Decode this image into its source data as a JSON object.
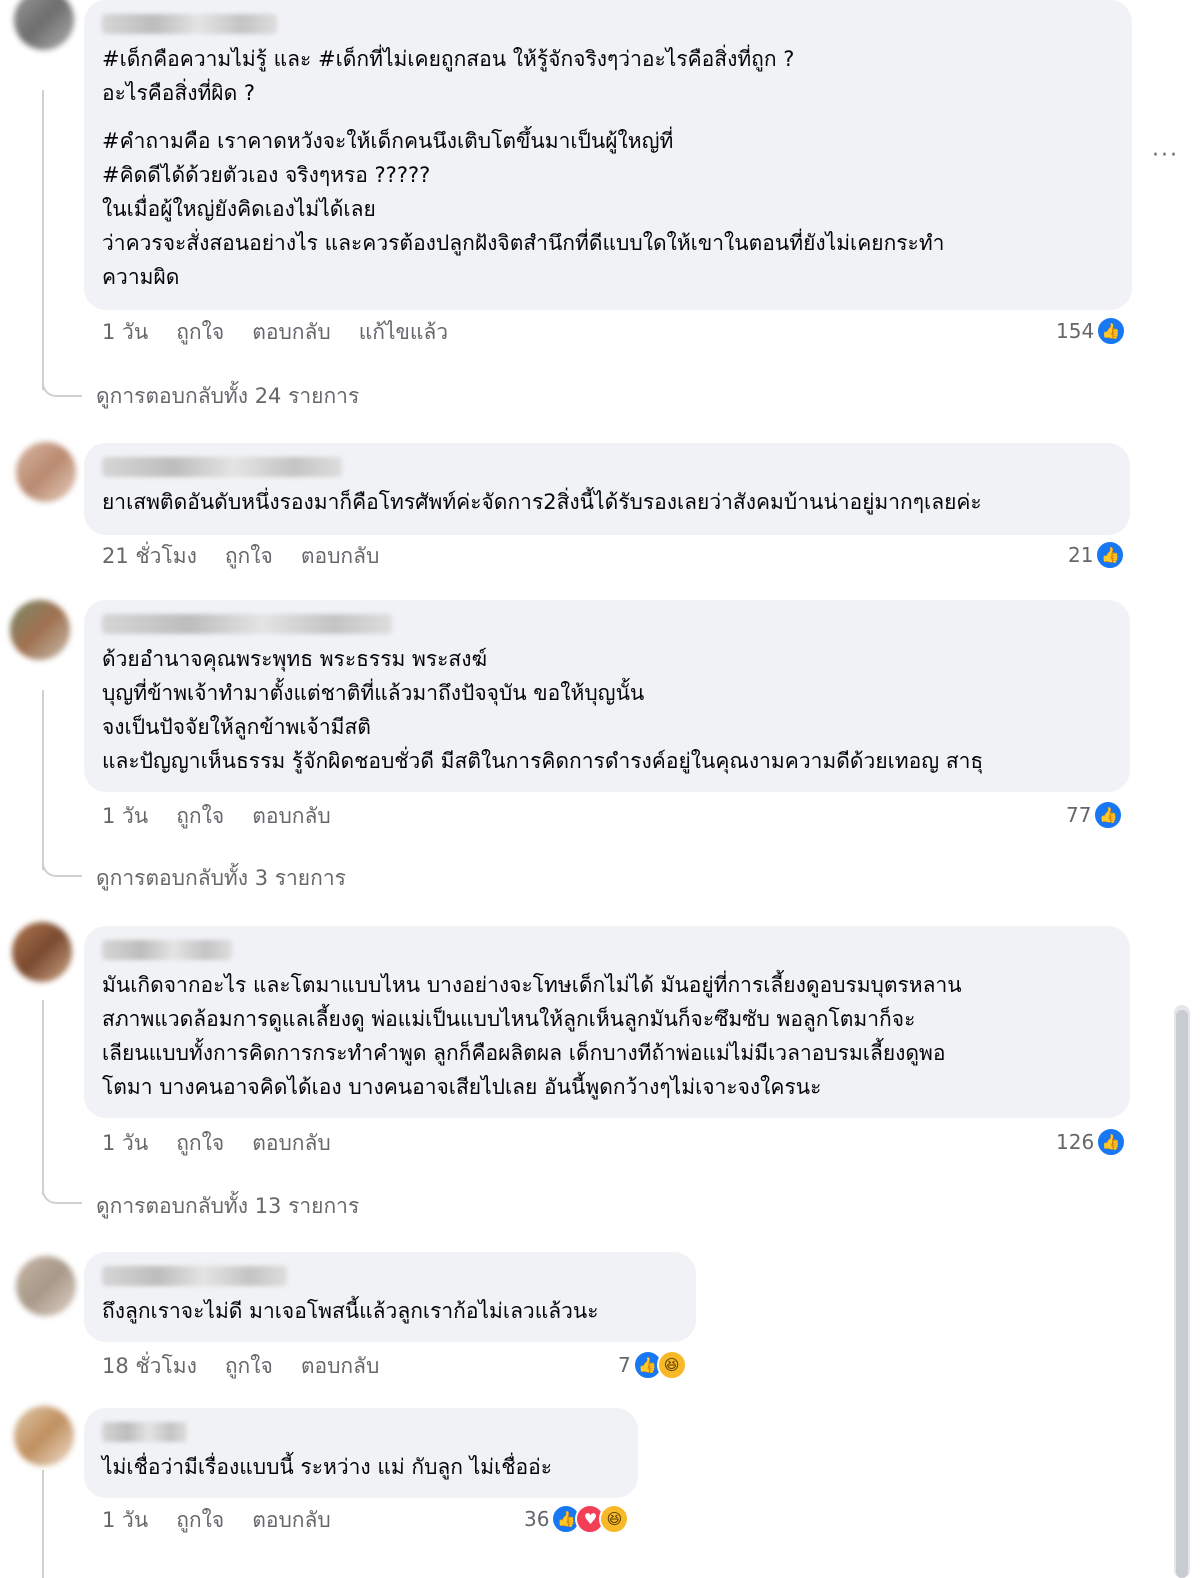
{
  "comments": [
    {
      "lines": [
        "#เด็กคือความไม่รู้ และ #เด็กที่ไม่เคยถูกสอน ให้รู้จักจริงๆว่าอะไรคือสิ่งที่ถูก ?",
        "อะไรคือสิ่งที่ผิด ?",
        "",
        "#คำถามคือ เราคาดหวังจะให้เด็กคนนึงเติบโตขึ้นมาเป็นผู้ใหญ่ที่",
        "#คิดดีได้ด้วยตัวเอง จริงๆหรอ ?????",
        "ในเมื่อผู้ใหญ่ยังคิดเองไม่ได้เลย",
        "ว่าควรจะสั่งสอนอย่างไร และควรต้องปลูกฝังจิตสำนึกที่ดีแบบใดให้เขาในตอนที่ยังไม่เคยกระทำ",
        "ความผิด"
      ],
      "time": "1 วัน",
      "like": "ถูกใจ",
      "reply": "ตอบกลับ",
      "edited": "แก้ไขแล้ว",
      "reaction_count": "154",
      "reactions": [
        "like"
      ],
      "view_replies": "ดูการตอบกลับทั้ง 24 รายการ"
    },
    {
      "lines": [
        "ยาเสพติดอันดับหนึ่งรองมาก็คือโทรศัพท์ค่ะจัดการ2สิ่งนี้ได้รับรองเลยว่าสังคมบ้านน่าอยู่มากๆเลยค่ะ"
      ],
      "time": "21 ชั่วโมง",
      "like": "ถูกใจ",
      "reply": "ตอบกลับ",
      "reaction_count": "21",
      "reactions": [
        "like"
      ]
    },
    {
      "lines": [
        "ด้วยอำนาจคุณพระพุทธ พระธรรม พระสงฆ์",
        "บุญที่ข้าพเจ้าทำมาตั้งแต่ชาติที่แล้วมาถึงปัจจุบัน ขอให้บุญนั้น",
        "จงเป็นปัจจัยให้ลูกข้าพเจ้ามีสติ",
        "และปัญญาเห็นธรรม รู้จักผิดชอบชั่วดี มีสติในการคิดการดำรงค์อยู่ในคุณงามความดีด้วยเทอญ สาธุ"
      ],
      "time": "1 วัน",
      "like": "ถูกใจ",
      "reply": "ตอบกลับ",
      "reaction_count": "77",
      "reactions": [
        "like"
      ],
      "view_replies": "ดูการตอบกลับทั้ง 3 รายการ"
    },
    {
      "lines": [
        "มันเกิดจากอะไร และโตมาแบบไหน บางอย่างจะโทษเด็กไม่ได้ มันอยู่ที่การเลี้ยงดูอบรมบุตรหลาน",
        "สภาพแวดล้อมการดูแลเลี้ยงดู พ่อแม่เป็นแบบไหนให้ลูกเห็นลูกมันก็จะซึมซับ พอลูกโตมาก็จะ",
        "เลียนแบบทั้งการคิดการกระทำคำพูด ลูกก็คือผลิตผล เด็กบางทีถ้าพ่อแม่ไม่มีเวลาอบรมเลี้ยงดูพอ",
        "โตมา บางคนอาจคิดได้เอง บางคนอาจเสียไปเลย อันนี้พูดกว้างๆไม่เจาะจงใครนะ"
      ],
      "time": "1 วัน",
      "like": "ถูกใจ",
      "reply": "ตอบกลับ",
      "reaction_count": "126",
      "reactions": [
        "like"
      ],
      "view_replies": "ดูการตอบกลับทั้ง 13 รายการ"
    },
    {
      "lines": [
        "ถึงลูกเราจะไม่ดี มาเจอโพสนี้แล้วลูกเราก้อไม่เลวแล้วนะ"
      ],
      "time": "18 ชั่วโมง",
      "like": "ถูกใจ",
      "reply": "ตอบกลับ",
      "reaction_count": "7",
      "reactions": [
        "like",
        "haha"
      ]
    },
    {
      "lines": [
        "ไม่เชื่อว่ามีเรื่องแบบนี้ ระหว่าง แม่ กับลูก ไม่เชื่ออ่ะ"
      ],
      "time": "1 วัน",
      "like": "ถูกใจ",
      "reply": "ตอบกลับ",
      "reaction_count": "36",
      "reactions": [
        "like",
        "love",
        "haha"
      ]
    }
  ],
  "more_options": "···",
  "colors": {
    "bubble": "#f0f2f5",
    "like": "#1877f2",
    "love": "#f33e58",
    "haha": "#f7b928",
    "meta": "#65676b"
  }
}
